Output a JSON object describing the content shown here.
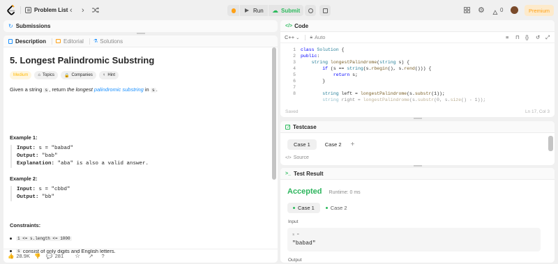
{
  "colors": {
    "brand": "#ffa116",
    "submit": "#2cbb5d",
    "accepted": "#2db55d",
    "medium": "#ffb800",
    "link": "#1a90ff"
  },
  "topbar": {
    "problem_list": "Problem List",
    "run": "Run",
    "submit": "Submit",
    "streak": "0",
    "premium": "Premium"
  },
  "submissions_panel": {
    "title": "Submissions"
  },
  "description_panel": {
    "tabs": [
      "Description",
      "Editorial",
      "Solutions"
    ],
    "title": "5. Longest Palindromic Substring",
    "difficulty": "Medium",
    "tags": [
      "Topics",
      "Companies",
      "Hint"
    ],
    "statement": {
      "p1": "Given a string ",
      "s": "s",
      "p2": ", return ",
      "em": "the longest",
      "link": "palindromic",
      "sub": "substring",
      "p3": " in ",
      "s2": "s",
      "p4": "."
    },
    "example1": {
      "heading": "Example 1:",
      "input_label": "Input:",
      "input": " s = \"babad\"",
      "output_label": "Output:",
      "output": " \"bab\"",
      "explanation_label": "Explanation:",
      "explanation": " \"aba\" is also a valid answer."
    },
    "example2": {
      "heading": "Example 2:",
      "input_label": "Input:",
      "input": " s = \"cbbd\"",
      "output_label": "Output:",
      "output": " \"bb\""
    },
    "constraints_heading": "Constraints:",
    "constraint1": "1 <= s.length <= 1000",
    "constraint2_code": "s",
    "constraint2_text": " consist of only digits and English letters.",
    "likes": "28.9K",
    "comments": "281"
  },
  "code_panel": {
    "title": "Code",
    "language": "C++",
    "auto": "Auto",
    "saved": "Saved",
    "cursor": "Ln 17, Col 3",
    "line_numbers": [
      "1",
      "2",
      "3",
      "4",
      "5",
      "6",
      "7",
      "8"
    ]
  },
  "testcase_panel": {
    "title": "Testcase",
    "cases": [
      "Case 1",
      "Case 2"
    ],
    "add": "+",
    "source": "Source"
  },
  "result_panel": {
    "title": "Test Result",
    "status": "Accepted",
    "runtime": "Runtime: 0 ms",
    "cases": [
      "Case 1",
      "Case 2"
    ],
    "input_label": "Input",
    "var_name": "s =",
    "var_value": "\"babad\"",
    "output_label": "Output"
  }
}
